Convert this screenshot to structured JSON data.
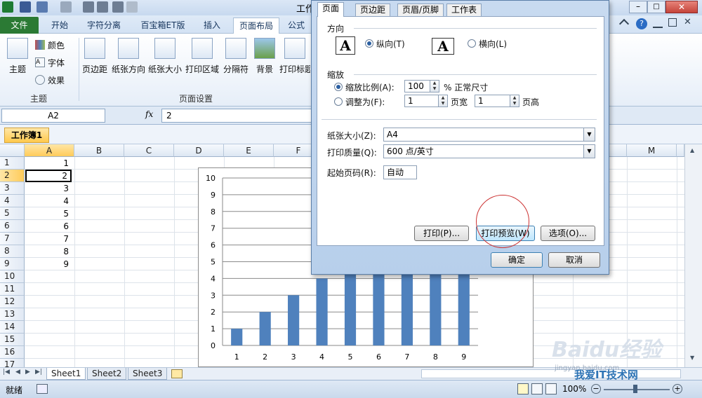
{
  "window": {
    "title": "工作"
  },
  "tabs": {
    "file": "文件",
    "items": [
      "开始",
      "字符分离",
      "百宝箱ET版",
      "插入",
      "页面布局",
      "公式"
    ]
  },
  "ribbon": {
    "theme_buttons": {
      "main": "主题",
      "colors": "颜色",
      "fonts": "字体",
      "effects": "效果"
    },
    "page_setup_buttons": [
      "页边距",
      "纸张方向",
      "纸张大小",
      "打印区域",
      "分隔符",
      "背景",
      "打印标题"
    ],
    "groups": {
      "theme": "主题",
      "page_setup": "页面设置"
    }
  },
  "formula_bar": {
    "name_box": "A2",
    "fx": "fx",
    "value": "2"
  },
  "workbook": {
    "tab": "工作簿1"
  },
  "grid": {
    "columns": [
      "A",
      "B",
      "C",
      "D",
      "E",
      "F",
      "M"
    ],
    "rows": [
      "1",
      "2",
      "3",
      "4",
      "5",
      "6",
      "7",
      "8",
      "9",
      "10",
      "11",
      "12",
      "13",
      "14",
      "15",
      "16",
      "17"
    ],
    "col_a_values": [
      "1",
      "2",
      "3",
      "4",
      "5",
      "6",
      "7",
      "8",
      "9"
    ]
  },
  "sheets": [
    "Sheet1",
    "Sheet2",
    "Sheet3"
  ],
  "status": {
    "ready": "就绪",
    "zoom": "100%"
  },
  "chart_data": {
    "type": "bar",
    "categories": [
      "1",
      "2",
      "3",
      "4",
      "5",
      "6",
      "7",
      "8",
      "9"
    ],
    "values": [
      1,
      2,
      3,
      4,
      5,
      6,
      7,
      8,
      9
    ],
    "ylim": [
      0,
      10
    ],
    "yticks": [
      "0",
      "1",
      "2",
      "3",
      "4",
      "5",
      "6",
      "7",
      "8",
      "9",
      "10"
    ],
    "color": "#4f81bd",
    "grid": true
  },
  "dialog": {
    "tabs": [
      "页面",
      "页边距",
      "页眉/页脚",
      "工作表"
    ],
    "orientation_label": "方向",
    "portrait": "纵向(T)",
    "landscape": "横向(L)",
    "scaling_label": "缩放",
    "scale_ratio": "缩放比例(A):",
    "scale_value": "100",
    "scale_unit": "% 正常尺寸",
    "fit_to": "调整为(F):",
    "fit_wide_value": "1",
    "fit_wide_label": "页宽",
    "fit_tall_value": "1",
    "fit_tall_label": "页高",
    "paper_size_label": "纸张大小(Z):",
    "paper_size": "A4",
    "print_quality_label": "打印质量(Q):",
    "print_quality": "600 点/英寸",
    "first_page_label": "起始页码(R):",
    "first_page": "自动",
    "print_btn": "打印(P)...",
    "preview_btn": "打印预览(W)",
    "options_btn": "选项(O)...",
    "ok_btn": "确定",
    "cancel_btn": "取消",
    "paper_glyph": "A"
  },
  "watermark": {
    "text1": "Baidu经验",
    "text2": "我爱IT技术网",
    "text3": "jingyan.baidu.com"
  }
}
